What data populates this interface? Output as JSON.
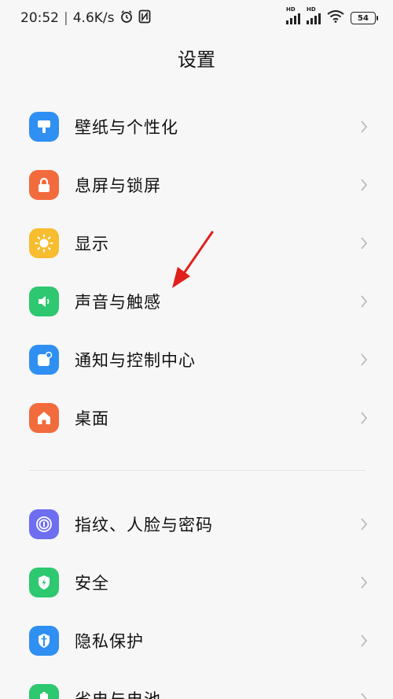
{
  "status_bar": {
    "time": "20:52",
    "separator": "|",
    "net_speed": "4.6K/s",
    "signal1_label": "HD",
    "signal2_label": "HD",
    "battery": "54"
  },
  "header": {
    "title": "设置"
  },
  "groups": [
    {
      "items": [
        {
          "label": "壁纸与个性化",
          "icon": "wallpaper-icon",
          "color": "#2f8ff2"
        },
        {
          "label": "息屏与锁屏",
          "icon": "lock-icon",
          "color": "#f26b3d"
        },
        {
          "label": "显示",
          "icon": "brightness-icon",
          "color": "#f7bd2f"
        },
        {
          "label": "声音与触感",
          "icon": "speaker-icon",
          "color": "#2dc86f"
        },
        {
          "label": "通知与控制中心",
          "icon": "notification-icon",
          "color": "#2f8ff2"
        },
        {
          "label": "桌面",
          "icon": "home-icon",
          "color": "#f26b3d"
        }
      ]
    },
    {
      "items": [
        {
          "label": "指纹、人脸与密码",
          "icon": "fingerprint-icon",
          "color": "#6d6ef0"
        },
        {
          "label": "安全",
          "icon": "shield-icon",
          "color": "#2dc86f"
        },
        {
          "label": "隐私保护",
          "icon": "privacy-icon",
          "color": "#2f8ff2"
        },
        {
          "label": "省电与电池",
          "icon": "battery-icon",
          "color": "#2dc86f"
        }
      ]
    }
  ],
  "annotation": {
    "arrow_color": "#e0201c"
  }
}
